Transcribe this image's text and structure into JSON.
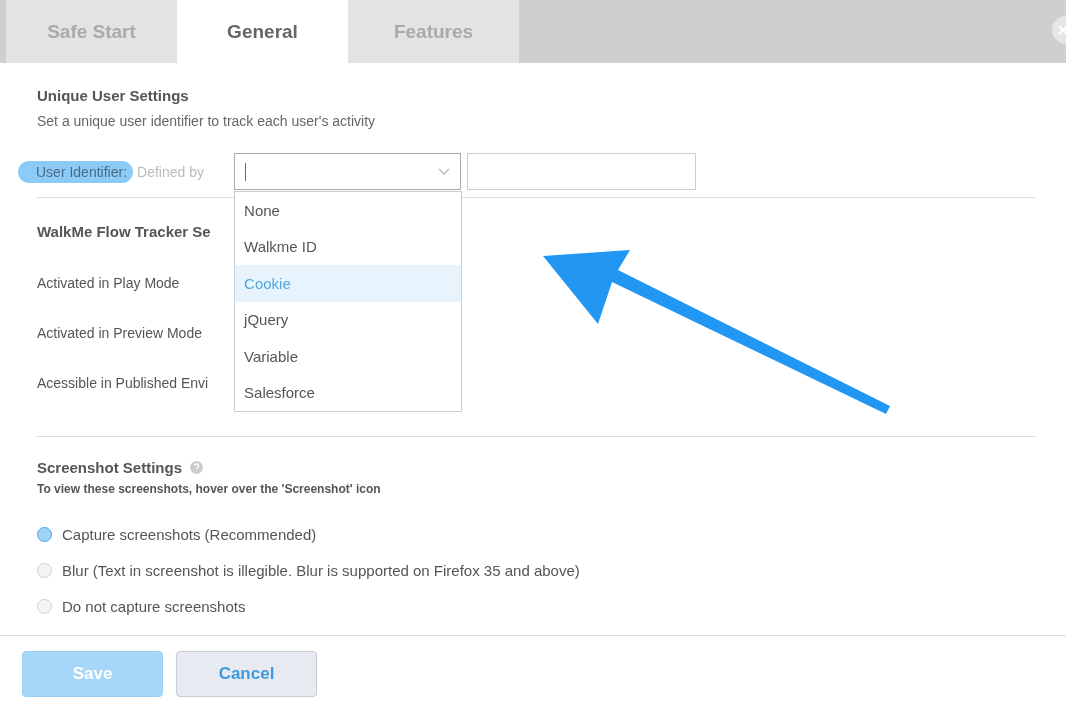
{
  "tabs": [
    {
      "label": "Safe Start",
      "selected": false
    },
    {
      "label": "General",
      "selected": true
    },
    {
      "label": "Features",
      "selected": false
    }
  ],
  "unique_user": {
    "title": "Unique User Settings",
    "description": "Set a unique user identifier to track each user's activity",
    "identifier_label": "User Identifier:",
    "defined_by": "Defined by",
    "dropdown": {
      "expanded": true,
      "options": [
        {
          "label": "None",
          "selected": false
        },
        {
          "label": "Walkme ID",
          "selected": false
        },
        {
          "label": "Cookie",
          "selected": true
        },
        {
          "label": "jQuery",
          "selected": false
        },
        {
          "label": "Variable",
          "selected": false
        },
        {
          "label": "Salesforce",
          "selected": false
        }
      ]
    }
  },
  "flow_tracker": {
    "title": "WalkMe Flow Tracker Se",
    "rows": [
      "Activated in Play Mode",
      "Activated in Preview Mode",
      "Acessible in Published Envi"
    ]
  },
  "screenshot": {
    "title": "Screenshot Settings",
    "hint": "To view these screenshots, hover over the 'Screenshot' icon",
    "options": [
      {
        "label": "Capture screenshots (Recommended)",
        "selected": true
      },
      {
        "label": "Blur (Text in screenshot is illegible. Blur is supported on Firefox 35 and above)",
        "selected": false
      },
      {
        "label": "Do not capture screenshots",
        "selected": false
      }
    ]
  },
  "buttons": [
    {
      "label": "Save",
      "kind": "primary",
      "disabled": true
    },
    {
      "label": "Cancel",
      "kind": "secondary",
      "disabled": false
    }
  ]
}
